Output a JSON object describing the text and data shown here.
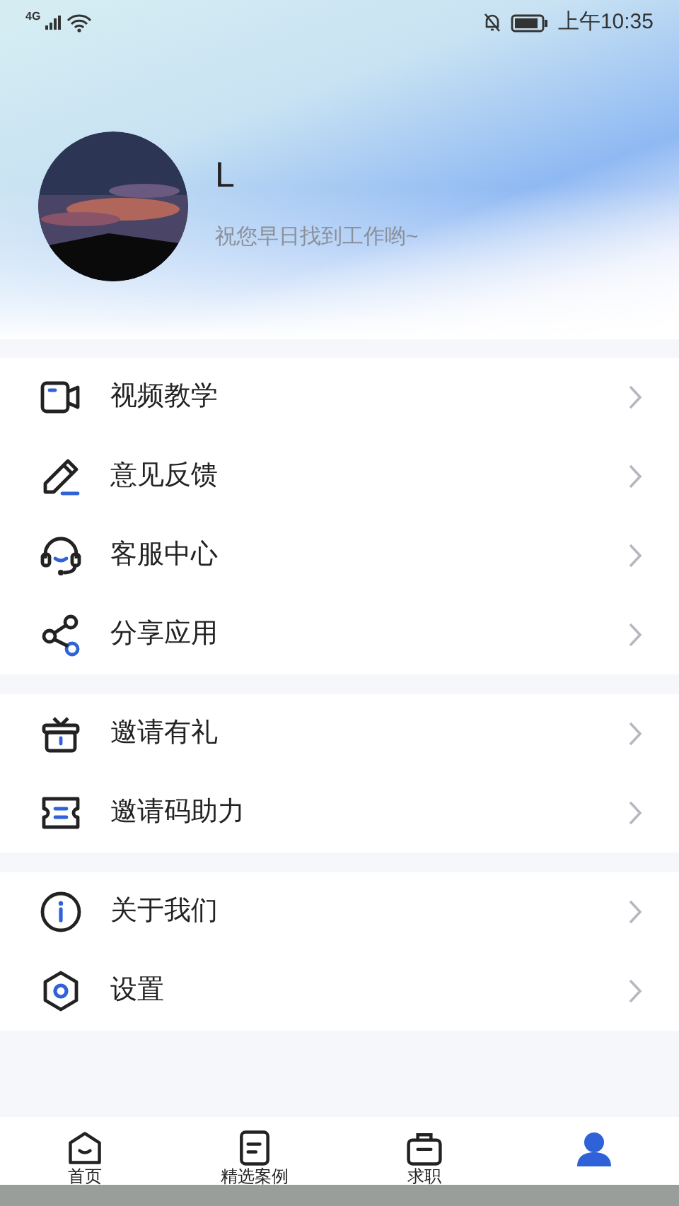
{
  "status_bar": {
    "network": "4G",
    "time": "上午10:35"
  },
  "profile": {
    "name": "L",
    "tagline": "祝您早日找到工作哟~"
  },
  "menu_groups": [
    {
      "items": [
        {
          "label": "视频教学"
        },
        {
          "label": "意见反馈"
        },
        {
          "label": "客服中心"
        },
        {
          "label": "分享应用"
        }
      ]
    },
    {
      "items": [
        {
          "label": "邀请有礼"
        },
        {
          "label": "邀请码助力"
        }
      ]
    },
    {
      "items": [
        {
          "label": "关于我们"
        },
        {
          "label": "设置"
        }
      ]
    }
  ],
  "tab_bar": [
    {
      "label": "首页",
      "selected": false
    },
    {
      "label": "精选案例",
      "selected": false
    },
    {
      "label": "求职",
      "selected": false
    },
    {
      "selected": true
    }
  ]
}
